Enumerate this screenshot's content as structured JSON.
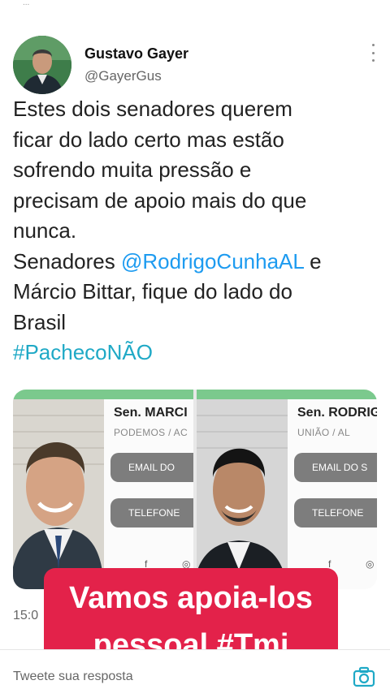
{
  "status_bar": {
    "glyph": "..."
  },
  "author": {
    "name": "Gustavo Gayer",
    "handle": "@GayerGus",
    "avatar_icon": "avatar-photo"
  },
  "tweet": {
    "lines": [
      "Estes dois senadores querem",
      "ficar do lado certo mas estão",
      "sofrendo muita pressão e",
      "precisam de apoio mais do que",
      "nunca."
    ],
    "line6_prefix": "Senadores ",
    "mention": "@RodrigoCunhaAL",
    "line6_suffix": " e",
    "line7": "Márcio Bittar, fique do lado do",
    "line8": "Brasil",
    "hashtag": "#PachecoNÃO"
  },
  "media": {
    "card_left": {
      "title": "Sen. MARCI",
      "party": "PODEMOS / AC",
      "email_label": "EMAIL DO",
      "phone_label": "TELEFONE"
    },
    "card_right": {
      "title": "Sen. RODRIG",
      "party": "UNIÃO / AL",
      "email_label": "EMAIL DO S",
      "phone_label": "TELEFONE"
    },
    "social_icons": [
      "facebook-icon",
      "instagram-icon"
    ]
  },
  "timestamp": "15:0",
  "overlay": {
    "line1": "Vamos apoia-los",
    "line2": "pessoal #Tmj",
    "color": "#e3224a"
  },
  "reply": {
    "placeholder": "Tweete sua resposta",
    "camera_icon": "camera-icon"
  },
  "colors": {
    "link": "#1d9bf0",
    "hashtag": "#1fa9c6",
    "card_accent": "#7bc98d"
  }
}
